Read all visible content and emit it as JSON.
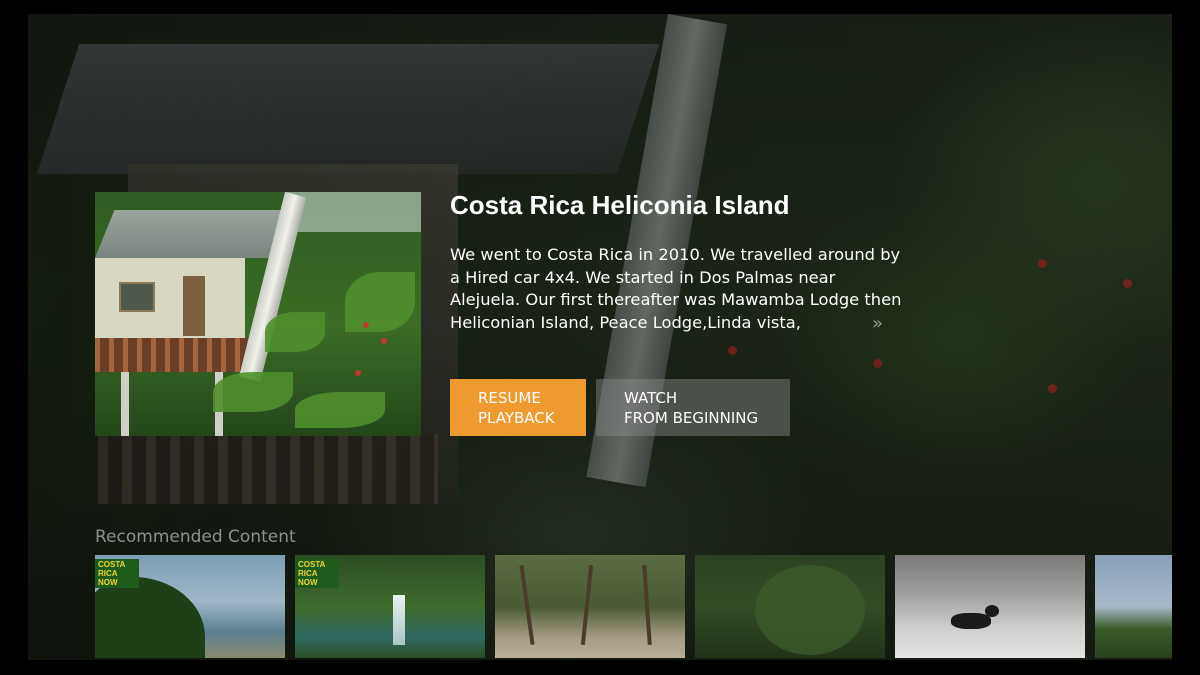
{
  "detail": {
    "title": "Costa Rica Heliconia Island",
    "description": "We went to Costa Rica in 2010. We travelled around by a Hired car 4x4. We started in Dos Palmas near Alejuela. Our first thereafter was Mawamba Lodge then Heliconian Island, Peace Lodge,Linda vista,",
    "more_icon": "»"
  },
  "actions": {
    "resume_label": "Resume\nPlayback",
    "watch_label": "Watch\nfrom Beginning"
  },
  "recommended": {
    "label": "Recommended Content",
    "tiles": [
      {
        "badge": "COSTA\nRICA NOW"
      },
      {
        "badge": "COSTA\nRICA NOW"
      },
      {
        "badge": ""
      },
      {
        "badge": ""
      },
      {
        "badge": ""
      },
      {
        "badge": ""
      }
    ]
  },
  "colors": {
    "accent": "#ef9a2e",
    "secondary_button": "rgba(140,140,140,0.45)",
    "muted_text": "#8f8f8f"
  }
}
